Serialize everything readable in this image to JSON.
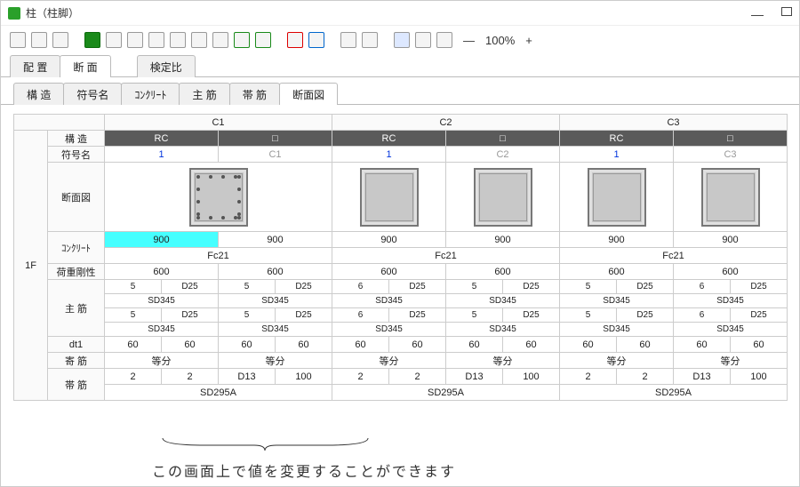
{
  "window": {
    "title": "柱（柱脚）"
  },
  "toolbar": {
    "zoom": "100%"
  },
  "tabs1": {
    "t0": "配 置",
    "t1": "断 面",
    "t2": "検定比"
  },
  "tabs2": {
    "t0": "構 造",
    "t1": "符号名",
    "t2": "ｺﾝｸﾘｰﾄ",
    "t3": "主 筋",
    "t4": "帯 筋",
    "t5": "断面図"
  },
  "head": {
    "c1": "C1",
    "c2": "C2",
    "c3": "C3",
    "rc": "RC",
    "sq": "□"
  },
  "rowlabels": {
    "kozo": "構 造",
    "fugo": "符号名",
    "danmen": "断面図",
    "con": "ｺﾝｸﾘｰﾄ",
    "kaju": "荷重剛性",
    "shukin": "主 筋",
    "dt1": "dt1",
    "yose": "寄 筋",
    "obi": "帯 筋"
  },
  "floor": "1F",
  "fugo": {
    "n": "1",
    "c1": "C1",
    "c2": "C2",
    "c3": "C3"
  },
  "con": {
    "v": "900",
    "label": "Fc21"
  },
  "kaju": {
    "v": "600"
  },
  "shukin": {
    "a1": "5",
    "a1b": "D25",
    "a2": "5",
    "a2b": "D25",
    "b1": "6",
    "b2": "D25",
    "b3": "5",
    "b4": "D25",
    "c1": "5",
    "c2": "D25",
    "c3": "6",
    "c4": "D25",
    "sd": "SD345"
  },
  "shukin2": {
    "a1": "5",
    "a1b": "D25",
    "a2": "5",
    "a2b": "D25",
    "b1": "6",
    "b2": "D25",
    "b3": "5",
    "b4": "D25",
    "c1": "5",
    "c2": "D25",
    "c3": "6",
    "c4": "D25"
  },
  "dt1": {
    "v1": "60",
    "v2": "60",
    "v3": "60",
    "v4": "60"
  },
  "yose": {
    "t": "等分"
  },
  "obi": {
    "v1": "2",
    "v2": "2",
    "v3": "D13",
    "v4": "100",
    "sd": "SD295A"
  },
  "annotation": "この画面上で値を変更することができます"
}
